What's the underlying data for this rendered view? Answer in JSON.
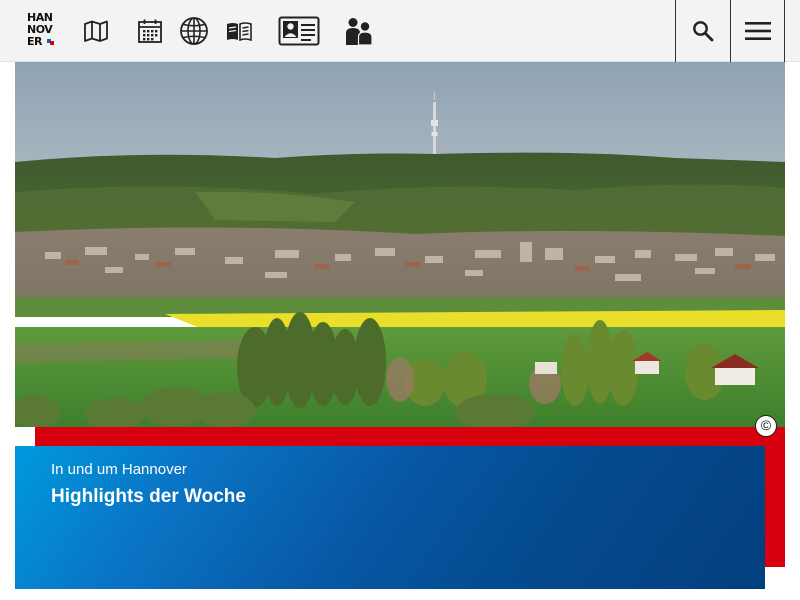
{
  "header": {
    "logo": {
      "line1": "HAN",
      "line2": "NOV",
      "line3": "ER",
      "mark_colors": [
        "#d7000f",
        "#0069b4"
      ]
    },
    "nav_icons": [
      {
        "name": "map-icon"
      },
      {
        "name": "calendar-icon"
      },
      {
        "name": "globe-icon"
      },
      {
        "name": "book-icon"
      },
      {
        "name": "id-card-icon"
      },
      {
        "name": "people-icon"
      }
    ],
    "search_icon": "search-icon",
    "menu_icon": "hamburger-menu-icon"
  },
  "hero": {
    "image_icon": "landscape-photo",
    "copyright_symbol": "©"
  },
  "teaser": {
    "kicker": "In und um Hannover",
    "headline": "Highlights der Woche"
  },
  "colors": {
    "accent_red": "#d7000f",
    "blue_dark": "#033f7e",
    "blue_light": "#0099dd",
    "header_bg": "#f3f3f3"
  }
}
